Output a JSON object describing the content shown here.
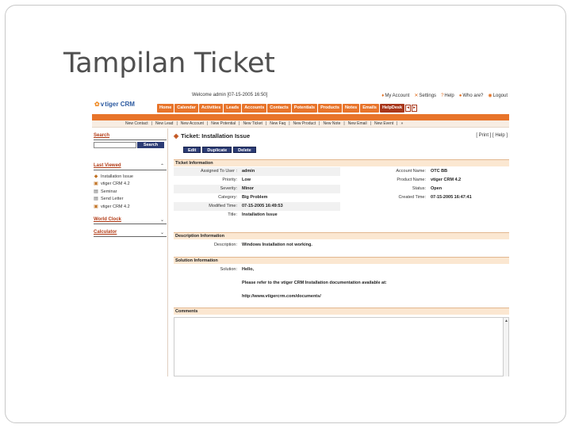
{
  "slide": {
    "title": "Tampilan Ticket"
  },
  "top": {
    "welcome": "Welcome admin  [07-15-2005 16:50]",
    "links": [
      "My Account",
      "Settings",
      "Help",
      "Who are?",
      "Logout"
    ]
  },
  "logo": {
    "text": "tiger CRM",
    "prefix": "v"
  },
  "nav": {
    "tabs": [
      "Home",
      "Calendar",
      "Activities",
      "Leads",
      "Accounts",
      "Contacts",
      "Potentials",
      "Products",
      "Notes",
      "Emails",
      "HelpDesk"
    ],
    "active": "HelpDesk",
    "arrows": [
      "◄",
      "►"
    ]
  },
  "subnav": [
    "New Contact",
    "|",
    "New Lead",
    "|",
    "New Account",
    "|",
    "New Potential",
    "|",
    "New Ticket",
    "|",
    "New Faq",
    "|",
    "New Product",
    "|",
    "New Note",
    "|",
    "New Email",
    "|",
    "New Event",
    "|",
    "»"
  ],
  "sidebar": {
    "search_label": "Search",
    "search_button": "Search",
    "last_viewed_label": "Last Viewed",
    "recent": [
      "Installation Issue",
      "vtiger CRM 4.2",
      "Seminar",
      "Send Letter",
      "vtiger CRM 4.2"
    ],
    "world_clock_label": "World Clock",
    "calculator_label": "Calculator",
    "collapse_up": "⌃",
    "collapse_down": "⌄"
  },
  "ticket": {
    "title": "Ticket: Installation Issue",
    "print_help": "[ Print ] [ Help ]",
    "buttons": {
      "edit": "Edit",
      "duplicate": "Duplicate",
      "delete": "Delete"
    },
    "info_header": "Ticket Information",
    "fields": [
      {
        "l1": "Assigned To User :",
        "v1": "admin",
        "l2": "Account Name:",
        "v2": "OTC BB"
      },
      {
        "l1": "Priority:",
        "v1": "Low",
        "l2": "Product Name:",
        "v2": "vtiger CRM 4.2"
      },
      {
        "l1": "Severity:",
        "v1": "Minor",
        "l2": "Status:",
        "v2": "Open"
      },
      {
        "l1": "Category:",
        "v1": "Big Problem",
        "l2": "Created Time:",
        "v2": "07-15-2005 16:47:41"
      },
      {
        "l1": "Modified Time:",
        "v1": "07-15-2005 16:49:53",
        "l2": "",
        "v2": ""
      },
      {
        "l1": "Title:",
        "v1": "Installation Issue",
        "l2": "",
        "v2": ""
      }
    ],
    "desc_header": "Description Information",
    "desc_label": "Description:",
    "desc_value": "Windows Installation not working.",
    "sol_header": "Solution Information",
    "sol_label": "Solution:",
    "sol_lines": [
      "Hello,",
      "Please refer to the vtiger CRM Installation documentation available at:",
      "http://www.vtigercrm.com/documents/"
    ],
    "comments_header": "Comments",
    "scroll_up": "▲"
  }
}
